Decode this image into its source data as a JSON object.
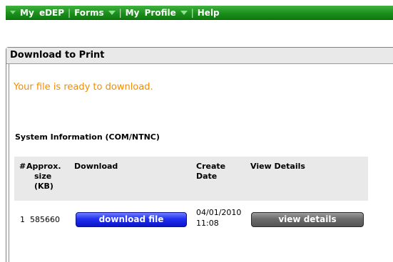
{
  "nav": {
    "my_edep": "My eDEP",
    "sep": "|",
    "forms": "Forms",
    "my_profile": "My Profile",
    "help": "Help"
  },
  "panel": {
    "title": "Download to Print",
    "ready_message": "Your file is ready to download.",
    "system_title": "System Information (COM/NTNC)"
  },
  "table": {
    "headers": {
      "num": "#",
      "size_1": "Approx.",
      "size_2": "size",
      "size_3": "(KB)",
      "download": "Download",
      "date_1": "Create",
      "date_2": "Date",
      "details": "View Details"
    },
    "rows": [
      {
        "num": "1",
        "size": "585660",
        "download_label": "download file",
        "date": "04/01/2010",
        "time": "11:08",
        "details_label": "view details"
      }
    ]
  },
  "colors": {
    "nav_green": "#1d8f1d",
    "ready_orange": "#f28c00",
    "download_blue": "#2230f0",
    "details_gray": "#6b6b6b"
  }
}
